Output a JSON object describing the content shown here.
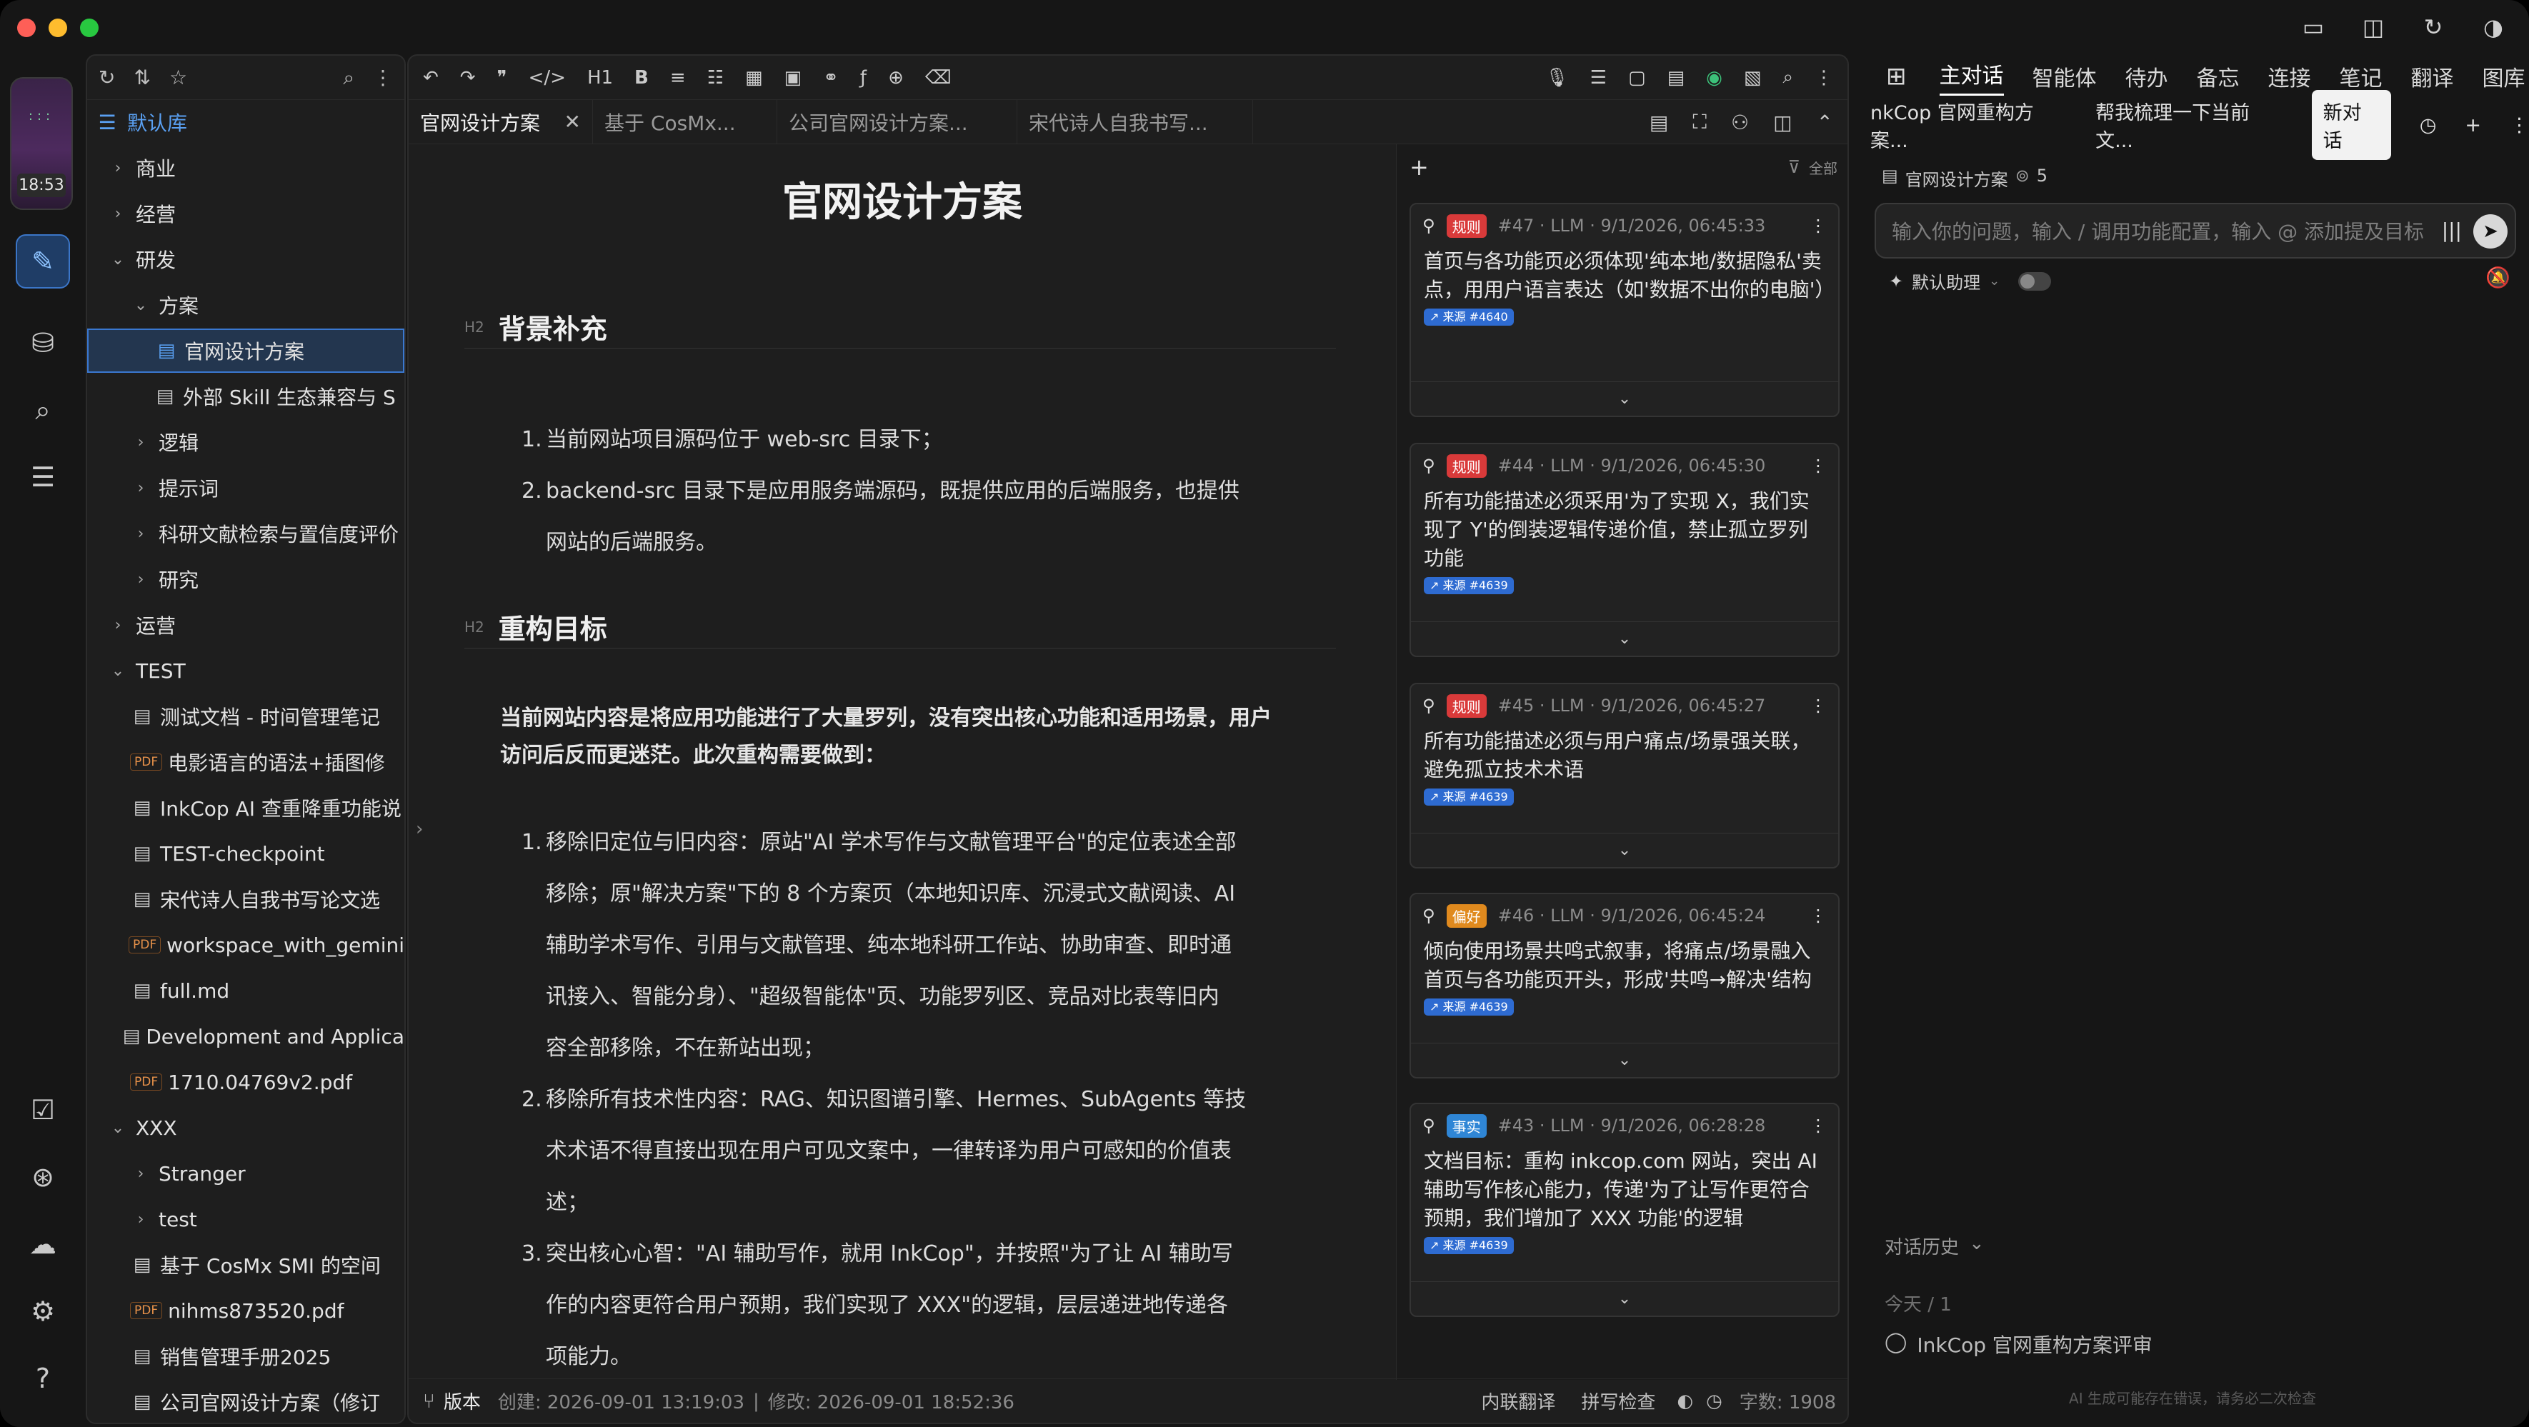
{
  "activity": {
    "time": "18:53"
  },
  "tree": {
    "root": "默认库",
    "items": [
      {
        "label": "商业",
        "level": 1,
        "kind": "folder",
        "open": false
      },
      {
        "label": "经营",
        "level": 1,
        "kind": "folder",
        "open": false
      },
      {
        "label": "研发",
        "level": 1,
        "kind": "folder",
        "open": true
      },
      {
        "label": "方案",
        "level": 2,
        "kind": "folder",
        "open": true
      },
      {
        "label": "官网设计方案",
        "level": 3,
        "kind": "doc",
        "selected": true
      },
      {
        "label": "外部 Skill 生态兼容与 S",
        "level": 3,
        "kind": "doc"
      },
      {
        "label": "逻辑",
        "level": 2,
        "kind": "folder",
        "open": false
      },
      {
        "label": "提示词",
        "level": 2,
        "kind": "folder",
        "open": false
      },
      {
        "label": "科研文献检索与置信度评价",
        "level": 2,
        "kind": "folder",
        "open": false
      },
      {
        "label": "研究",
        "level": 2,
        "kind": "folder",
        "open": false
      },
      {
        "label": "运营",
        "level": 1,
        "kind": "folder",
        "open": false
      },
      {
        "label": "TEST",
        "level": 1,
        "kind": "folder",
        "open": true
      },
      {
        "label": "测试文档 - 时间管理笔记",
        "level": 2,
        "kind": "doc"
      },
      {
        "label": "电影语言的语法+插图修",
        "level": 2,
        "kind": "pdf"
      },
      {
        "label": "InkCop AI 查重降重功能说",
        "level": 2,
        "kind": "doc"
      },
      {
        "label": "TEST-checkpoint",
        "level": 2,
        "kind": "doc"
      },
      {
        "label": "宋代诗人自我书写论文选",
        "level": 2,
        "kind": "doc"
      },
      {
        "label": "workspace_with_gemini",
        "level": 2,
        "kind": "pdf"
      },
      {
        "label": "full.md",
        "level": 2,
        "kind": "doc"
      },
      {
        "label": "Development and Applica",
        "level": 2,
        "kind": "doc"
      },
      {
        "label": "1710.04769v2.pdf",
        "level": 2,
        "kind": "pdf"
      },
      {
        "label": "XXX",
        "level": 1,
        "kind": "folder",
        "open": true
      },
      {
        "label": "Stranger",
        "level": 2,
        "kind": "folder",
        "open": false
      },
      {
        "label": "test",
        "level": 2,
        "kind": "folder",
        "open": false
      },
      {
        "label": "基于 CosMx SMI 的空间",
        "level": 2,
        "kind": "doc"
      },
      {
        "label": "nihms873520.pdf",
        "level": 2,
        "kind": "pdf"
      },
      {
        "label": "销售管理手册2025",
        "level": 2,
        "kind": "doc"
      },
      {
        "label": "公司官网设计方案（修订",
        "level": 2,
        "kind": "doc"
      }
    ]
  },
  "tabs": [
    "官网设计方案",
    "基于 CosMx...",
    "公司官网设计方案...",
    "宋代诗人自我书写..."
  ],
  "doc": {
    "title": "官网设计方案",
    "h2_tag": "H2",
    "section1": "背景补充",
    "s1_items": [
      "当前网站项目源码位于 web-src 目录下；",
      "backend-src 目录下是应用服务端源码，既提供应用的后端服务，也提供",
      "网站的后端服务。"
    ],
    "section2": "重构目标",
    "intro": [
      "当前网站内容是将应用功能进行了大量罗列，没有突出核心功能和适用场景，用户",
      "访问后反而更迷茫。此次重构需要做到："
    ],
    "s2_lines": [
      "移除旧定位与旧内容：原站\"AI 学术写作与文献管理平台\"的定位表述全部",
      "移除；原\"解决方案\"下的 8 个方案页（本地知识库、沉浸式文献阅读、AI",
      "辅助学术写作、引用与文献管理、纯本地科研工作站、协助审查、即时通",
      "讯接入、智能分身）、\"超级智能体\"页、功能罗列区、竞品对比表等旧内",
      "容全部移除，不在新站出现；",
      "移除所有技术性内容：RAG、知识图谱引擎、Hermes、SubAgents 等技",
      "术术语不得直接出现在用户可见文案中，一律转译为用户可感知的价值表",
      "述；",
      "突出核心心智：\"AI 辅助写作，就用 InkCop\"，并按照\"为了让 AI 辅助写",
      "作的内容更符合用户预期，我们实现了 XXX\"的逻辑，层层递进地传递各",
      "项能力。"
    ]
  },
  "status": {
    "version": "版本",
    "created": "创建: 2026-09-01 13:19:03",
    "sep": "|",
    "modified": "修改: 2026-09-01 18:52:36",
    "translate": "内联翻译",
    "spell": "拼写检查",
    "words": "字数: 1908"
  },
  "memo": {
    "filter": "全部",
    "cards": [
      {
        "badge": "规则",
        "badge_color": "#d93a3a",
        "meta": "#47 · LLM · 9/1/2026, 06:45:33",
        "text": [
          "首页与各功能页必须体现'纯本地/数据隐私'卖",
          "点，用用户语言表达（如'数据不出你的电脑'）"
        ],
        "src": "来源 #4640"
      },
      {
        "badge": "规则",
        "badge_color": "#d93a3a",
        "meta": "#44 · LLM · 9/1/2026, 06:45:30",
        "text": [
          "所有功能描述必须采用'为了实现 X，我们实",
          "现了 Y'的倒装逻辑传递价值，禁止孤立罗列",
          "功能"
        ],
        "src": "来源 #4639"
      },
      {
        "badge": "规则",
        "badge_color": "#d93a3a",
        "meta": "#45 · LLM · 9/1/2026, 06:45:27",
        "text": [
          "所有功能描述必须与用户痛点/场景强关联，",
          "避免孤立技术术语"
        ],
        "src": "来源 #4639"
      },
      {
        "badge": "偏好",
        "badge_color": "#e08a1e",
        "meta": "#46 · LLM · 9/1/2026, 06:45:24",
        "text": [
          "倾向使用场景共鸣式叙事，将痛点/场景融入",
          "首页与各功能页开头，形成'共鸣→解决'结构"
        ],
        "src": "来源 #4639"
      },
      {
        "badge": "事实",
        "badge_color": "#2f86d6",
        "meta": "#43 · LLM · 9/1/2026, 06:28:28",
        "text": [
          "文档目标：重构 inkcop.com 网站，突出 AI",
          "辅助写作核心能力，传递'为了让写作更符合",
          "预期，我们增加了 XXX 功能'的逻辑"
        ],
        "src": "来源 #4639"
      }
    ]
  },
  "chat": {
    "nav": [
      "主对话",
      "智能体",
      "待办",
      "备忘",
      "连接",
      "笔记",
      "翻译",
      "图库"
    ],
    "sessions": [
      "nkCop 官网重构方案...",
      "帮我梳理一下当前文..."
    ],
    "new_chat": "新对话",
    "context": "官网设计方案",
    "context_count": "5",
    "placeholder": "输入你的问题，输入 / 调用功能配置，输入 @ 添加提及目标",
    "assistant": "默认助理",
    "history_label": "对话历史",
    "today": "今天 / 1",
    "history_item": "InkCop 官网重构方案评审",
    "disclaimer": "AI 生成可能存在错误，请务必二次检查"
  }
}
